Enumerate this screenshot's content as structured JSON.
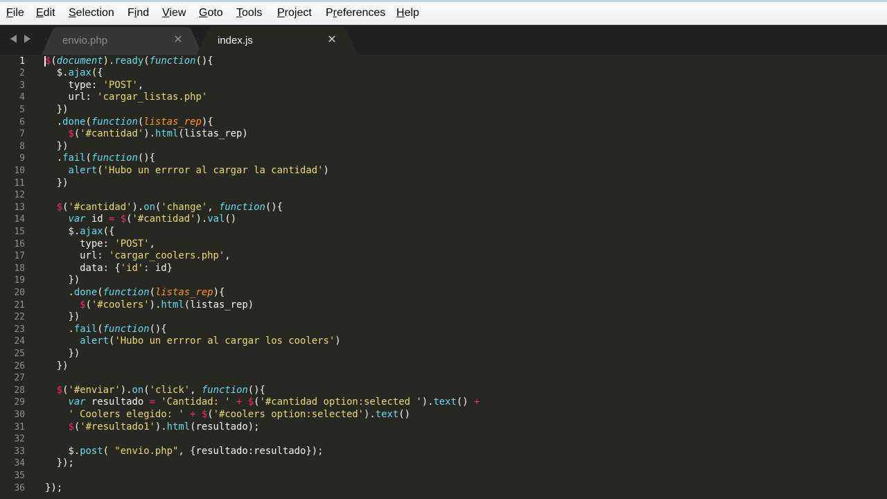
{
  "menu": [
    {
      "label": "File",
      "mnemonic_index": 0
    },
    {
      "label": "Edit",
      "mnemonic_index": 0
    },
    {
      "label": "Selection",
      "mnemonic_index": 0
    },
    {
      "label": "Find",
      "mnemonic_index": 1
    },
    {
      "label": "View",
      "mnemonic_index": 0
    },
    {
      "label": "Goto",
      "mnemonic_index": 0
    },
    {
      "label": "Tools",
      "mnemonic_index": 0
    },
    {
      "label": "Project",
      "mnemonic_index": 0
    },
    {
      "label": "Preferences",
      "mnemonic_index": 1
    },
    {
      "label": "Help",
      "mnemonic_index": 0
    }
  ],
  "tabs": [
    {
      "label": "envio.php",
      "active": false
    },
    {
      "label": "index.js",
      "active": true
    }
  ],
  "close_glyph": "✕",
  "theme": {
    "background": "#272822",
    "foreground": "#f8f8f2",
    "string": "#e6db74",
    "function": "#66d9ef",
    "keyword": "#66d9ef",
    "operator": "#f92672",
    "parameter": "#fd971f",
    "line_number": "#90908a"
  },
  "editor": {
    "active_line": 1,
    "lines": [
      [
        [
          "operator",
          "$"
        ],
        [
          "plain",
          "("
        ],
        [
          "keyword",
          "document"
        ],
        [
          "plain",
          ")."
        ],
        [
          "func",
          "ready"
        ],
        [
          "plain",
          "("
        ],
        [
          "keyword",
          "function"
        ],
        [
          "plain",
          "(){"
        ]
      ],
      [
        [
          "plain",
          "  $."
        ],
        [
          "func",
          "ajax"
        ],
        [
          "plain",
          "({"
        ]
      ],
      [
        [
          "plain",
          "    type: "
        ],
        [
          "string",
          "'POST'"
        ],
        [
          "plain",
          ","
        ]
      ],
      [
        [
          "plain",
          "    url: "
        ],
        [
          "string",
          "'cargar_listas.php'"
        ]
      ],
      [
        [
          "plain",
          "  })"
        ]
      ],
      [
        [
          "plain",
          "  ."
        ],
        [
          "func",
          "done"
        ],
        [
          "plain",
          "("
        ],
        [
          "keyword",
          "function"
        ],
        [
          "plain",
          "("
        ],
        [
          "param",
          "listas_rep"
        ],
        [
          "plain",
          "){"
        ]
      ],
      [
        [
          "plain",
          "    "
        ],
        [
          "operator",
          "$"
        ],
        [
          "plain",
          "("
        ],
        [
          "string",
          "'#cantidad'"
        ],
        [
          "plain",
          ")."
        ],
        [
          "func",
          "html"
        ],
        [
          "plain",
          "(listas_rep)"
        ]
      ],
      [
        [
          "plain",
          "  })"
        ]
      ],
      [
        [
          "plain",
          "  ."
        ],
        [
          "func",
          "fail"
        ],
        [
          "plain",
          "("
        ],
        [
          "keyword",
          "function"
        ],
        [
          "plain",
          "(){"
        ]
      ],
      [
        [
          "plain",
          "    "
        ],
        [
          "func",
          "alert"
        ],
        [
          "plain",
          "("
        ],
        [
          "string",
          "'Hubo un errror al cargar la cantidad'"
        ],
        [
          "plain",
          ")"
        ]
      ],
      [
        [
          "plain",
          "  })"
        ]
      ],
      [],
      [
        [
          "plain",
          "  "
        ],
        [
          "operator",
          "$"
        ],
        [
          "plain",
          "("
        ],
        [
          "string",
          "'#cantidad'"
        ],
        [
          "plain",
          ")."
        ],
        [
          "func",
          "on"
        ],
        [
          "plain",
          "("
        ],
        [
          "string",
          "'change'"
        ],
        [
          "plain",
          ", "
        ],
        [
          "keyword",
          "function"
        ],
        [
          "plain",
          "(){"
        ]
      ],
      [
        [
          "plain",
          "    "
        ],
        [
          "keyword",
          "var"
        ],
        [
          "plain",
          " id "
        ],
        [
          "operator",
          "="
        ],
        [
          "plain",
          " "
        ],
        [
          "operator",
          "$"
        ],
        [
          "plain",
          "("
        ],
        [
          "string",
          "'#cantidad'"
        ],
        [
          "plain",
          ")."
        ],
        [
          "func",
          "val"
        ],
        [
          "plain",
          "()"
        ]
      ],
      [
        [
          "plain",
          "    $."
        ],
        [
          "func",
          "ajax"
        ],
        [
          "plain",
          "({"
        ]
      ],
      [
        [
          "plain",
          "      type: "
        ],
        [
          "string",
          "'POST'"
        ],
        [
          "plain",
          ","
        ]
      ],
      [
        [
          "plain",
          "      url: "
        ],
        [
          "string",
          "'cargar_coolers.php'"
        ],
        [
          "plain",
          ","
        ]
      ],
      [
        [
          "plain",
          "      data: {"
        ],
        [
          "string",
          "'id'"
        ],
        [
          "plain",
          ": id}"
        ]
      ],
      [
        [
          "plain",
          "    })"
        ]
      ],
      [
        [
          "plain",
          "    ."
        ],
        [
          "func",
          "done"
        ],
        [
          "plain",
          "("
        ],
        [
          "keyword",
          "function"
        ],
        [
          "plain",
          "("
        ],
        [
          "param",
          "listas_rep"
        ],
        [
          "plain",
          "){"
        ]
      ],
      [
        [
          "plain",
          "      "
        ],
        [
          "operator",
          "$"
        ],
        [
          "plain",
          "("
        ],
        [
          "string",
          "'#coolers'"
        ],
        [
          "plain",
          ")."
        ],
        [
          "func",
          "html"
        ],
        [
          "plain",
          "(listas_rep)"
        ]
      ],
      [
        [
          "plain",
          "    })"
        ]
      ],
      [
        [
          "plain",
          "    ."
        ],
        [
          "func",
          "fail"
        ],
        [
          "plain",
          "("
        ],
        [
          "keyword",
          "function"
        ],
        [
          "plain",
          "(){"
        ]
      ],
      [
        [
          "plain",
          "      "
        ],
        [
          "func",
          "alert"
        ],
        [
          "plain",
          "("
        ],
        [
          "string",
          "'Hubo un errror al cargar los coolers'"
        ],
        [
          "plain",
          ")"
        ]
      ],
      [
        [
          "plain",
          "    })"
        ]
      ],
      [
        [
          "plain",
          "  })"
        ]
      ],
      [],
      [
        [
          "plain",
          "  "
        ],
        [
          "operator",
          "$"
        ],
        [
          "plain",
          "("
        ],
        [
          "string",
          "'#enviar'"
        ],
        [
          "plain",
          ")."
        ],
        [
          "func",
          "on"
        ],
        [
          "plain",
          "("
        ],
        [
          "string",
          "'click'"
        ],
        [
          "plain",
          ", "
        ],
        [
          "keyword",
          "function"
        ],
        [
          "plain",
          "(){"
        ]
      ],
      [
        [
          "plain",
          "    "
        ],
        [
          "keyword",
          "var"
        ],
        [
          "plain",
          " resultado "
        ],
        [
          "operator",
          "="
        ],
        [
          "plain",
          " "
        ],
        [
          "string",
          "'Cantidad: '"
        ],
        [
          "plain",
          " "
        ],
        [
          "operator",
          "+"
        ],
        [
          "plain",
          " "
        ],
        [
          "operator",
          "$"
        ],
        [
          "plain",
          "("
        ],
        [
          "string",
          "'#cantidad option:selected '"
        ],
        [
          "plain",
          ")."
        ],
        [
          "func",
          "text"
        ],
        [
          "plain",
          "() "
        ],
        [
          "operator",
          "+"
        ]
      ],
      [
        [
          "plain",
          "    "
        ],
        [
          "string",
          "' Coolers elegido: '"
        ],
        [
          "plain",
          " "
        ],
        [
          "operator",
          "+"
        ],
        [
          "plain",
          " "
        ],
        [
          "operator",
          "$"
        ],
        [
          "plain",
          "("
        ],
        [
          "string",
          "'#coolers option:selected'"
        ],
        [
          "plain",
          ")."
        ],
        [
          "func",
          "text"
        ],
        [
          "plain",
          "()"
        ]
      ],
      [
        [
          "plain",
          "    "
        ],
        [
          "operator",
          "$"
        ],
        [
          "plain",
          "("
        ],
        [
          "string",
          "'#resultado1'"
        ],
        [
          "plain",
          ")."
        ],
        [
          "func",
          "html"
        ],
        [
          "plain",
          "(resultado);"
        ]
      ],
      [],
      [
        [
          "plain",
          "    $."
        ],
        [
          "func",
          "post"
        ],
        [
          "plain",
          "( "
        ],
        [
          "string",
          "\"envio.php\""
        ],
        [
          "plain",
          ", {resultado:resultado});"
        ]
      ],
      [
        [
          "plain",
          "  });"
        ]
      ],
      [],
      [
        [
          "plain",
          "});"
        ]
      ]
    ]
  }
}
